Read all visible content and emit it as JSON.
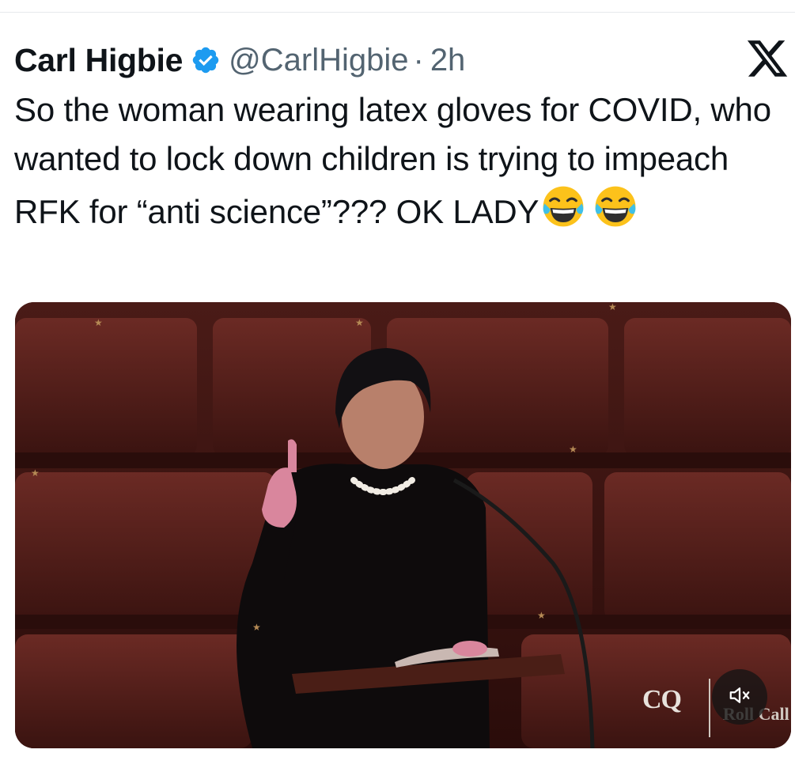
{
  "tweet": {
    "display_name": "Carl Higbie",
    "handle": "@CarlHigbie",
    "separator": "·",
    "time": "2h",
    "text": "So the woman wearing latex gloves for COVID, who wanted to lock down children is trying to impeach RFK for “anti science”??? OK LADY",
    "emojis": [
      "face-with-tears-of-joy",
      "face-with-tears-of-joy"
    ]
  },
  "icons": {
    "verified": "verified-badge-icon",
    "brand": "x-logo-icon",
    "mute": "volume-muted-icon"
  },
  "media": {
    "type": "video",
    "watermark": {
      "main": "CQ",
      "sub": "Roll Call"
    },
    "muted": true
  },
  "colors": {
    "verified_blue": "#1d9bf0",
    "text_primary": "#0f1419",
    "text_secondary": "#536471"
  }
}
